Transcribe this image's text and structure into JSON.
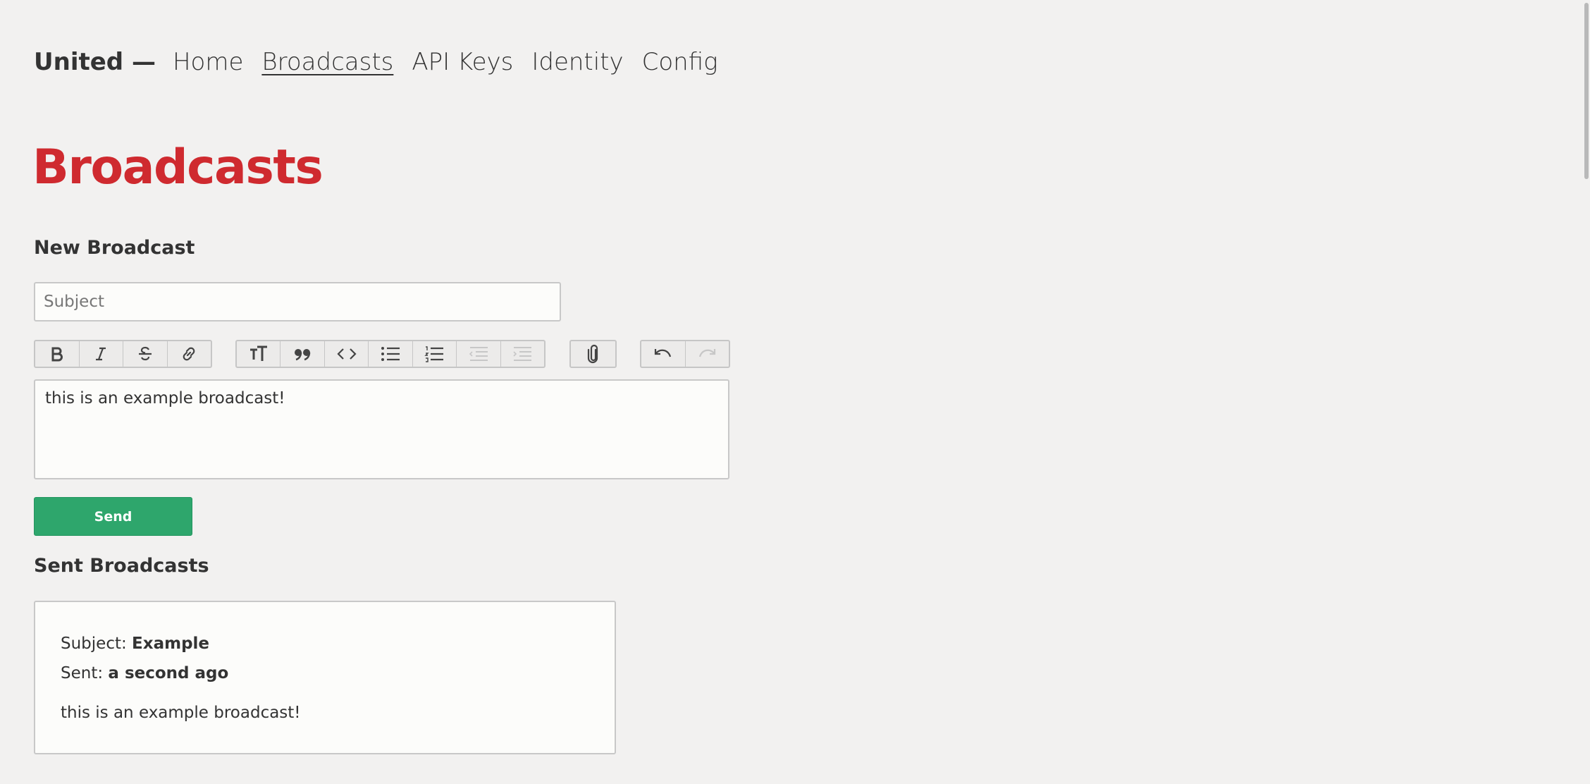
{
  "nav": {
    "brand": "United —",
    "items": [
      {
        "label": "Home"
      },
      {
        "label": "Broadcasts",
        "active": true
      },
      {
        "label": "API Keys"
      },
      {
        "label": "Identity"
      },
      {
        "label": "Config"
      }
    ]
  },
  "page_title": "Broadcasts",
  "new_broadcast": {
    "heading": "New Broadcast",
    "subject_placeholder": "Subject",
    "subject_value": "",
    "toolbar": {
      "groups": [
        [
          "bold-icon",
          "italic-icon",
          "strikethrough-icon",
          "link-icon"
        ],
        [
          "heading-icon",
          "quote-icon",
          "code-icon",
          "bullet-list-icon",
          "numbered-list-icon",
          "decrease-indent-icon",
          "increase-indent-icon"
        ],
        [
          "attach-icon"
        ],
        [
          "undo-icon",
          "redo-icon"
        ]
      ],
      "disabled": [
        "decrease-indent-icon",
        "increase-indent-icon",
        "redo-icon"
      ]
    },
    "editor_content": "this is an example broadcast!",
    "send_label": "Send"
  },
  "sent_broadcasts": {
    "heading": "Sent Broadcasts",
    "items": [
      {
        "subject_label": "Subject:",
        "subject": "Example",
        "sent_label": "Sent:",
        "sent": "a second ago",
        "body": "this is an example broadcast!"
      }
    ]
  },
  "colors": {
    "background": "#f2f1f0",
    "title_red": "#cf2a2f",
    "send_green": "#2ea66c"
  }
}
